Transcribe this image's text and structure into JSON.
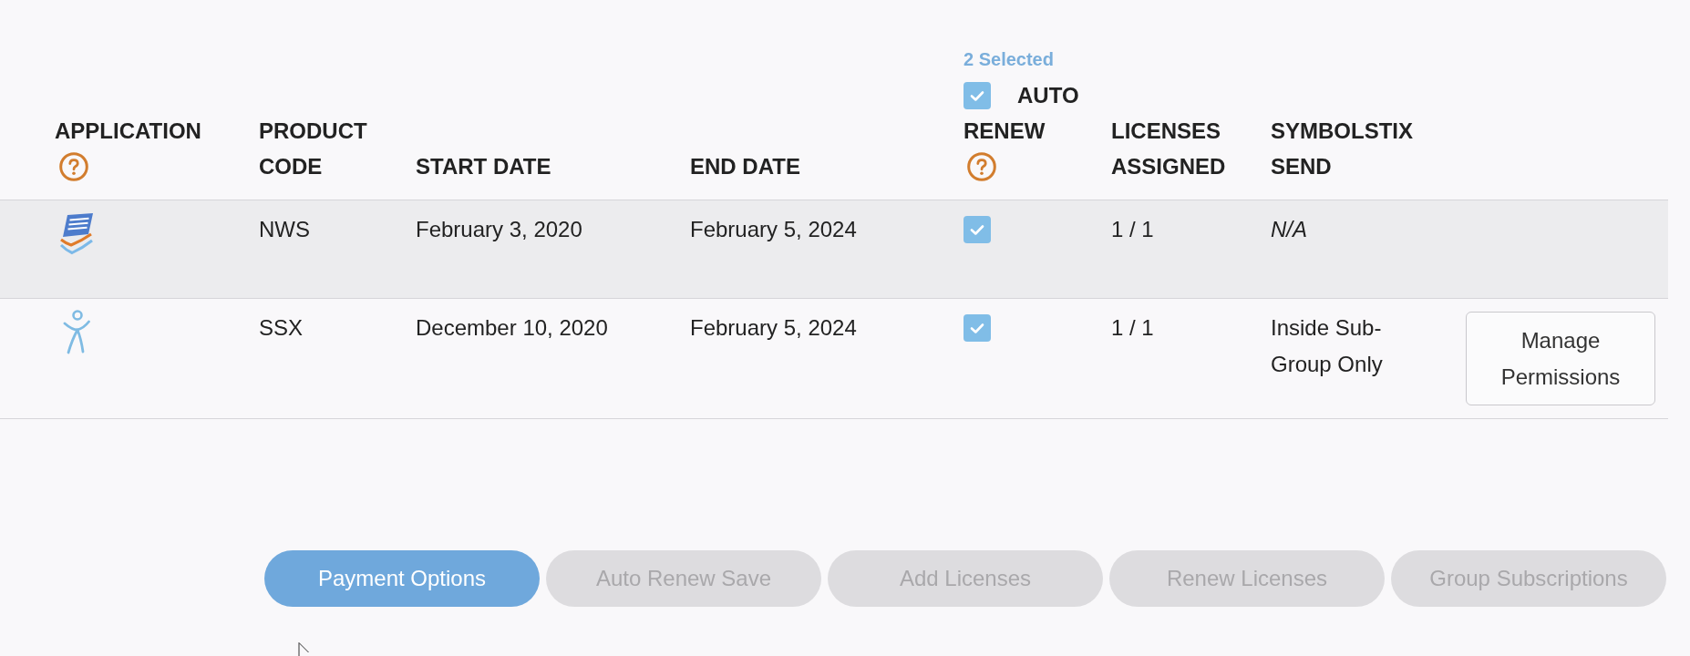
{
  "table": {
    "columns": [
      {
        "label": "APPLICATION",
        "help": true
      },
      {
        "label": "PRODUCT CODE",
        "help": false
      },
      {
        "label": "START DATE",
        "help": false
      },
      {
        "label": "END DATE",
        "help": false
      },
      {
        "label": "AUTO RENEW",
        "help": true,
        "selection_count": "2 Selected",
        "all_checked": true
      },
      {
        "label": "LICENSES ASSIGNED",
        "help": false
      },
      {
        "label": "SYMBOLSTIX SEND",
        "help": false
      }
    ],
    "rows": [
      {
        "kind": "papers",
        "highlighted": true,
        "product_code": "NWS",
        "start_date": "February 3, 2020",
        "end_date": "February 5, 2024",
        "auto_renew": true,
        "licenses_assigned": "1 / 1",
        "symbolstix_send": "N/A",
        "send_applicable": false
      },
      {
        "kind": "figure",
        "highlighted": false,
        "product_code": "SSX",
        "start_date": "December 10, 2020",
        "end_date": "February 5, 2024",
        "auto_renew": true,
        "licenses_assigned": "1 / 1",
        "symbolstix_send": "Inside Sub-Group Only",
        "send_applicable": true,
        "action": "Manage Permissions"
      }
    ]
  },
  "buttons": [
    {
      "label": "Payment Options",
      "disabled": false
    },
    {
      "label": "Auto Renew Save",
      "disabled": true
    },
    {
      "label": "Add Licenses",
      "disabled": true
    },
    {
      "label": "Renew Licenses",
      "disabled": true
    },
    {
      "label": "Group Subscriptions",
      "disabled": true
    }
  ]
}
